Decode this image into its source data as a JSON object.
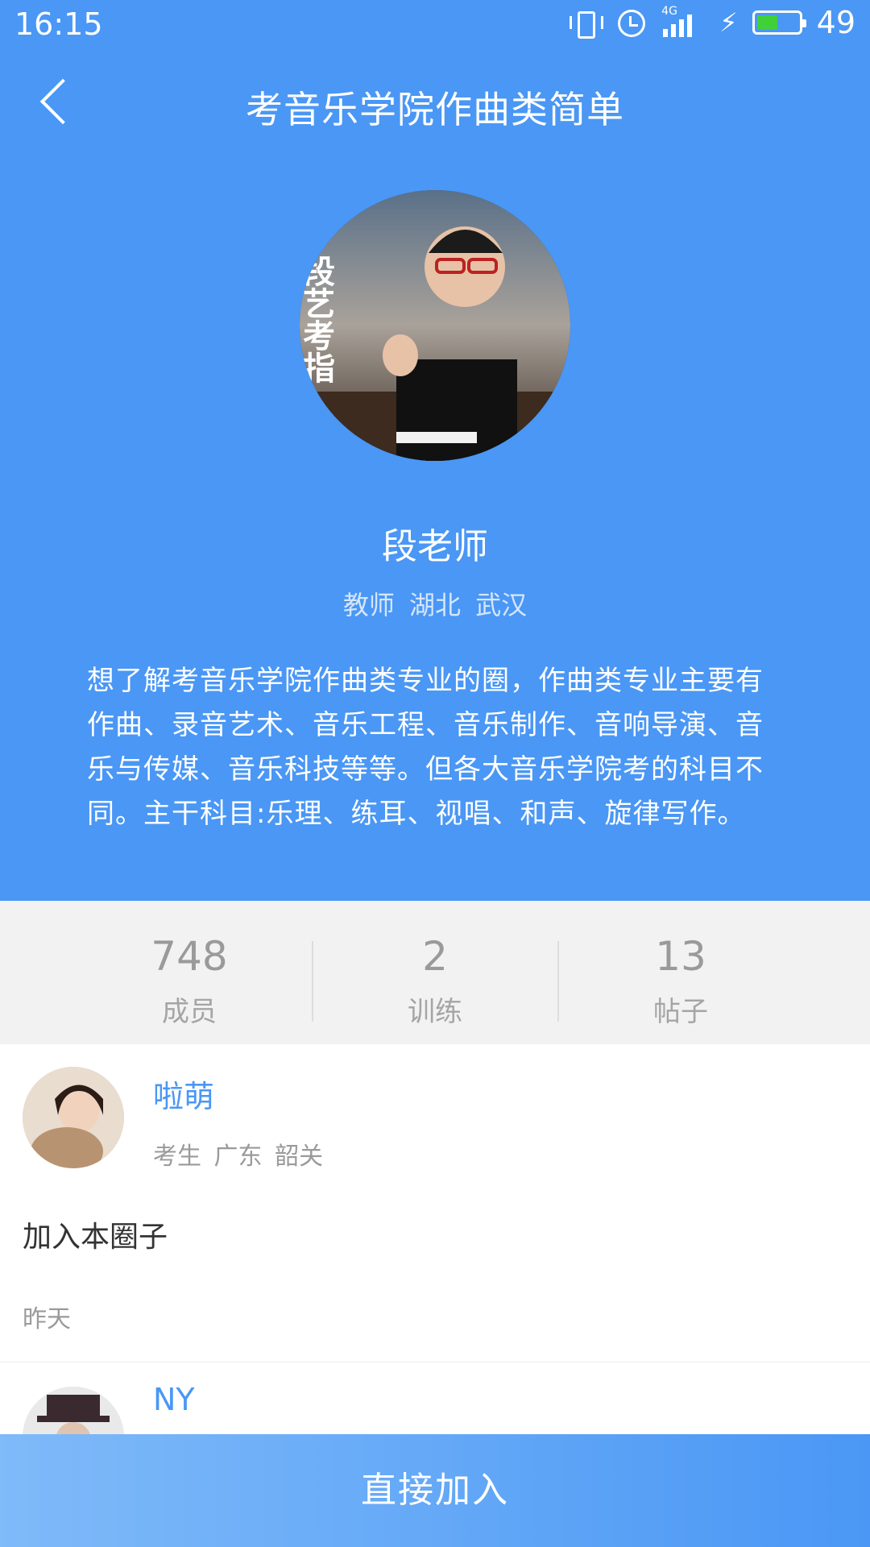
{
  "colors": {
    "accent": "#4a97f5",
    "button_start": "#7fbaf9",
    "button_end": "#4a97f5"
  },
  "status_bar": {
    "time": "16:15",
    "network": "4G",
    "battery": "49",
    "battery_level": 0.49,
    "icons": [
      "vibrate-icon",
      "alarm-icon",
      "signal-icon",
      "charging-icon",
      "battery-icon"
    ]
  },
  "header": {
    "title": "考音乐学院作曲类简单",
    "back_icon": "back-arrow-icon"
  },
  "teacher": {
    "name": "段老师",
    "role": "教师",
    "location": "湖北 武汉",
    "avatar_text": "段艺考指"
  },
  "intro": "想了解考音乐学院作曲类专业的圈，作曲类专业主要有作曲、录音艺术、音乐工程、音乐制作、音响导演、音乐与传媒、音乐科技等等。但各大音乐学院考的科目不同。主干科目:乐理、练耳、视唱、和声、旋律写作。",
  "stats": [
    {
      "value": "748",
      "label": "成员"
    },
    {
      "value": "2",
      "label": "训练"
    },
    {
      "value": "13",
      "label": "帖子"
    }
  ],
  "activities": [
    {
      "name": "啦萌",
      "role": "考生",
      "location": "广东 韶关",
      "action": "加入本圈子",
      "time": "昨天"
    },
    {
      "name": "NY"
    }
  ],
  "join_button": "直接加入"
}
